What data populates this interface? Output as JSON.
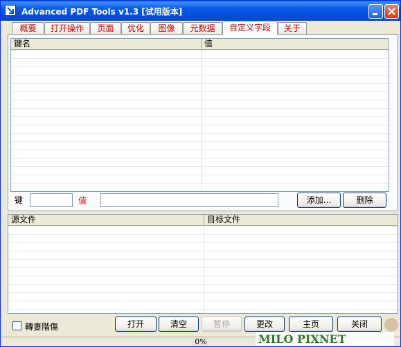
{
  "window": {
    "title": "Advanced PDF Tools  v1.3 [试用版本]"
  },
  "tabs": [
    {
      "label": "概要"
    },
    {
      "label": "打开操作"
    },
    {
      "label": "页面"
    },
    {
      "label": "优化"
    },
    {
      "label": "图像"
    },
    {
      "label": "元数据"
    },
    {
      "label": "自定义字段",
      "active": true
    },
    {
      "label": "关于"
    }
  ],
  "fields_list": {
    "col_key": "键名",
    "col_value": "值"
  },
  "entry": {
    "key_label": "键",
    "key_value": "",
    "value_label": "值",
    "value_value": "",
    "add_label": "添加...",
    "delete_label": "删除"
  },
  "files_list": {
    "col_source": "源文件",
    "col_target": "目标文件"
  },
  "footer": {
    "checkbox_label": "轉妻階傷",
    "open_label": "打开",
    "clear_label": "清空",
    "pause_label": "暂停",
    "change_label": "更改",
    "home_label": "主页",
    "close_label": "关闭"
  },
  "status": {
    "progress_text": "0%"
  },
  "watermark": {
    "text": "MILO PIXNET"
  },
  "colors": {
    "tab_text": "#c00000",
    "title_bar": "#0a58e6",
    "value_label": "#c00000"
  }
}
